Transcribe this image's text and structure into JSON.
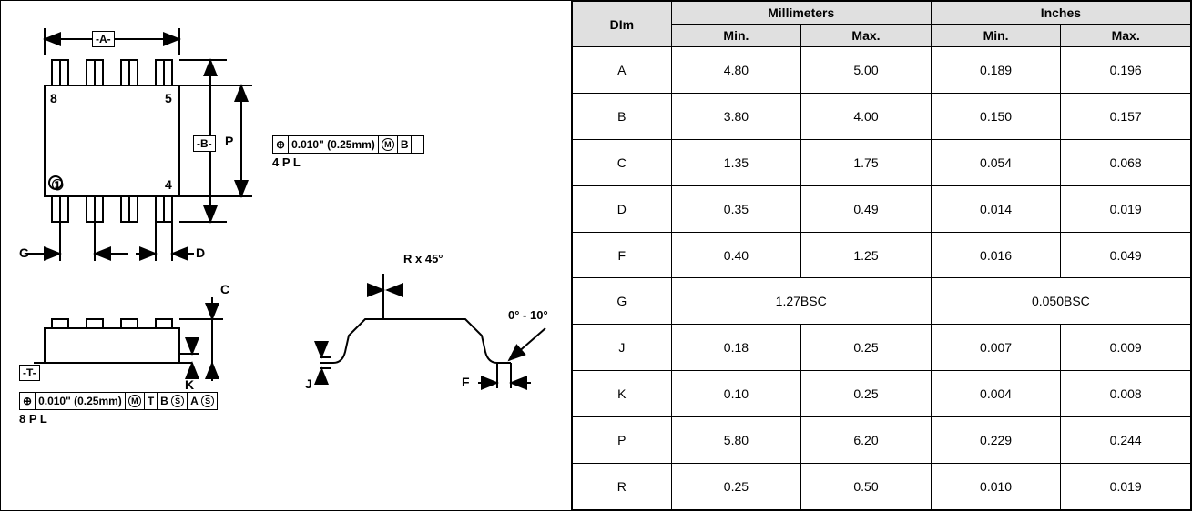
{
  "table": {
    "header_dim": "DIm",
    "header_mm": "Millimeters",
    "header_in": "Inches",
    "header_min": "Min.",
    "header_max": "Max.",
    "rows": [
      {
        "dim": "A",
        "mm_min": "4.80",
        "mm_max": "5.00",
        "in_min": "0.189",
        "in_max": "0.196"
      },
      {
        "dim": "B",
        "mm_min": "3.80",
        "mm_max": "4.00",
        "in_min": "0.150",
        "in_max": "0.157"
      },
      {
        "dim": "C",
        "mm_min": "1.35",
        "mm_max": "1.75",
        "in_min": "0.054",
        "in_max": "0.068"
      },
      {
        "dim": "D",
        "mm_min": "0.35",
        "mm_max": "0.49",
        "in_min": "0.014",
        "in_max": "0.019"
      },
      {
        "dim": "F",
        "mm_min": "0.40",
        "mm_max": "1.25",
        "in_min": "0.016",
        "in_max": "0.049"
      },
      {
        "dim": "G",
        "mm_span": "1.27BSC",
        "in_span": "0.050BSC"
      },
      {
        "dim": "J",
        "mm_min": "0.18",
        "mm_max": "0.25",
        "in_min": "0.007",
        "in_max": "0.009"
      },
      {
        "dim": "K",
        "mm_min": "0.10",
        "mm_max": "0.25",
        "in_min": "0.004",
        "in_max": "0.008"
      },
      {
        "dim": "P",
        "mm_min": "5.80",
        "mm_max": "6.20",
        "in_min": "0.229",
        "in_max": "0.244"
      },
      {
        "dim": "R",
        "mm_min": "0.25",
        "mm_max": "0.50",
        "in_min": "0.010",
        "in_max": "0.019"
      }
    ]
  },
  "diagram": {
    "datum_A": "-A-",
    "datum_B": "-B-",
    "datum_T": "-T-",
    "lbl_P": "P",
    "lbl_G": "G",
    "lbl_D": "D",
    "lbl_C": "C",
    "lbl_K": "K",
    "lbl_J": "J",
    "lbl_F": "F",
    "lbl_R": "R x 45°",
    "angle": "0° - 10°",
    "pin1": "1",
    "pin4": "4",
    "pin5": "5",
    "pin8": "8",
    "fcf_tol": "0.010\" (0.25mm)",
    "fcf_M": "M",
    "fcf_T": "T",
    "fcf_B": "B",
    "fcf_A": "A",
    "fcf_S": "S",
    "pl4": "4 P L",
    "pl8": "8 P L",
    "circle1": "①"
  }
}
